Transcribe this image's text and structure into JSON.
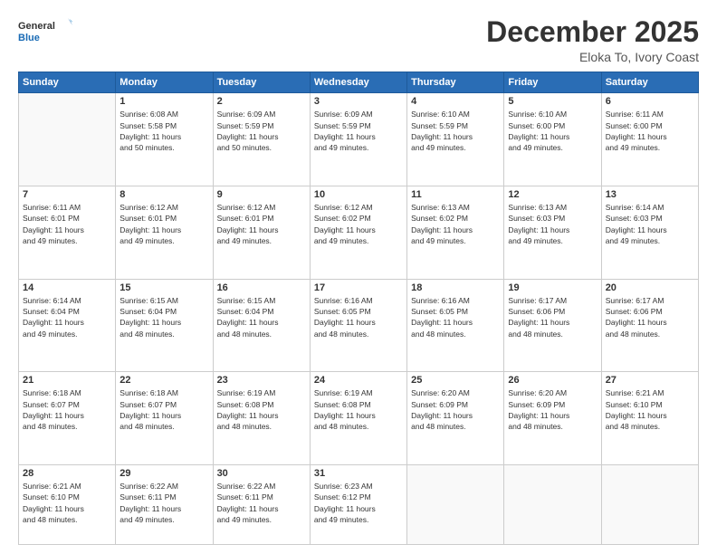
{
  "header": {
    "logo_general": "General",
    "logo_blue": "Blue",
    "month_title": "December 2025",
    "location": "Eloka To, Ivory Coast"
  },
  "days_of_week": [
    "Sunday",
    "Monday",
    "Tuesday",
    "Wednesday",
    "Thursday",
    "Friday",
    "Saturday"
  ],
  "weeks": [
    [
      {
        "day": "",
        "info": ""
      },
      {
        "day": "1",
        "info": "Sunrise: 6:08 AM\nSunset: 5:58 PM\nDaylight: 11 hours\nand 50 minutes."
      },
      {
        "day": "2",
        "info": "Sunrise: 6:09 AM\nSunset: 5:59 PM\nDaylight: 11 hours\nand 50 minutes."
      },
      {
        "day": "3",
        "info": "Sunrise: 6:09 AM\nSunset: 5:59 PM\nDaylight: 11 hours\nand 49 minutes."
      },
      {
        "day": "4",
        "info": "Sunrise: 6:10 AM\nSunset: 5:59 PM\nDaylight: 11 hours\nand 49 minutes."
      },
      {
        "day": "5",
        "info": "Sunrise: 6:10 AM\nSunset: 6:00 PM\nDaylight: 11 hours\nand 49 minutes."
      },
      {
        "day": "6",
        "info": "Sunrise: 6:11 AM\nSunset: 6:00 PM\nDaylight: 11 hours\nand 49 minutes."
      }
    ],
    [
      {
        "day": "7",
        "info": "Sunrise: 6:11 AM\nSunset: 6:01 PM\nDaylight: 11 hours\nand 49 minutes."
      },
      {
        "day": "8",
        "info": "Sunrise: 6:12 AM\nSunset: 6:01 PM\nDaylight: 11 hours\nand 49 minutes."
      },
      {
        "day": "9",
        "info": "Sunrise: 6:12 AM\nSunset: 6:01 PM\nDaylight: 11 hours\nand 49 minutes."
      },
      {
        "day": "10",
        "info": "Sunrise: 6:12 AM\nSunset: 6:02 PM\nDaylight: 11 hours\nand 49 minutes."
      },
      {
        "day": "11",
        "info": "Sunrise: 6:13 AM\nSunset: 6:02 PM\nDaylight: 11 hours\nand 49 minutes."
      },
      {
        "day": "12",
        "info": "Sunrise: 6:13 AM\nSunset: 6:03 PM\nDaylight: 11 hours\nand 49 minutes."
      },
      {
        "day": "13",
        "info": "Sunrise: 6:14 AM\nSunset: 6:03 PM\nDaylight: 11 hours\nand 49 minutes."
      }
    ],
    [
      {
        "day": "14",
        "info": "Sunrise: 6:14 AM\nSunset: 6:04 PM\nDaylight: 11 hours\nand 49 minutes."
      },
      {
        "day": "15",
        "info": "Sunrise: 6:15 AM\nSunset: 6:04 PM\nDaylight: 11 hours\nand 48 minutes."
      },
      {
        "day": "16",
        "info": "Sunrise: 6:15 AM\nSunset: 6:04 PM\nDaylight: 11 hours\nand 48 minutes."
      },
      {
        "day": "17",
        "info": "Sunrise: 6:16 AM\nSunset: 6:05 PM\nDaylight: 11 hours\nand 48 minutes."
      },
      {
        "day": "18",
        "info": "Sunrise: 6:16 AM\nSunset: 6:05 PM\nDaylight: 11 hours\nand 48 minutes."
      },
      {
        "day": "19",
        "info": "Sunrise: 6:17 AM\nSunset: 6:06 PM\nDaylight: 11 hours\nand 48 minutes."
      },
      {
        "day": "20",
        "info": "Sunrise: 6:17 AM\nSunset: 6:06 PM\nDaylight: 11 hours\nand 48 minutes."
      }
    ],
    [
      {
        "day": "21",
        "info": "Sunrise: 6:18 AM\nSunset: 6:07 PM\nDaylight: 11 hours\nand 48 minutes."
      },
      {
        "day": "22",
        "info": "Sunrise: 6:18 AM\nSunset: 6:07 PM\nDaylight: 11 hours\nand 48 minutes."
      },
      {
        "day": "23",
        "info": "Sunrise: 6:19 AM\nSunset: 6:08 PM\nDaylight: 11 hours\nand 48 minutes."
      },
      {
        "day": "24",
        "info": "Sunrise: 6:19 AM\nSunset: 6:08 PM\nDaylight: 11 hours\nand 48 minutes."
      },
      {
        "day": "25",
        "info": "Sunrise: 6:20 AM\nSunset: 6:09 PM\nDaylight: 11 hours\nand 48 minutes."
      },
      {
        "day": "26",
        "info": "Sunrise: 6:20 AM\nSunset: 6:09 PM\nDaylight: 11 hours\nand 48 minutes."
      },
      {
        "day": "27",
        "info": "Sunrise: 6:21 AM\nSunset: 6:10 PM\nDaylight: 11 hours\nand 48 minutes."
      }
    ],
    [
      {
        "day": "28",
        "info": "Sunrise: 6:21 AM\nSunset: 6:10 PM\nDaylight: 11 hours\nand 48 minutes."
      },
      {
        "day": "29",
        "info": "Sunrise: 6:22 AM\nSunset: 6:11 PM\nDaylight: 11 hours\nand 49 minutes."
      },
      {
        "day": "30",
        "info": "Sunrise: 6:22 AM\nSunset: 6:11 PM\nDaylight: 11 hours\nand 49 minutes."
      },
      {
        "day": "31",
        "info": "Sunrise: 6:23 AM\nSunset: 6:12 PM\nDaylight: 11 hours\nand 49 minutes."
      },
      {
        "day": "",
        "info": ""
      },
      {
        "day": "",
        "info": ""
      },
      {
        "day": "",
        "info": ""
      }
    ]
  ]
}
